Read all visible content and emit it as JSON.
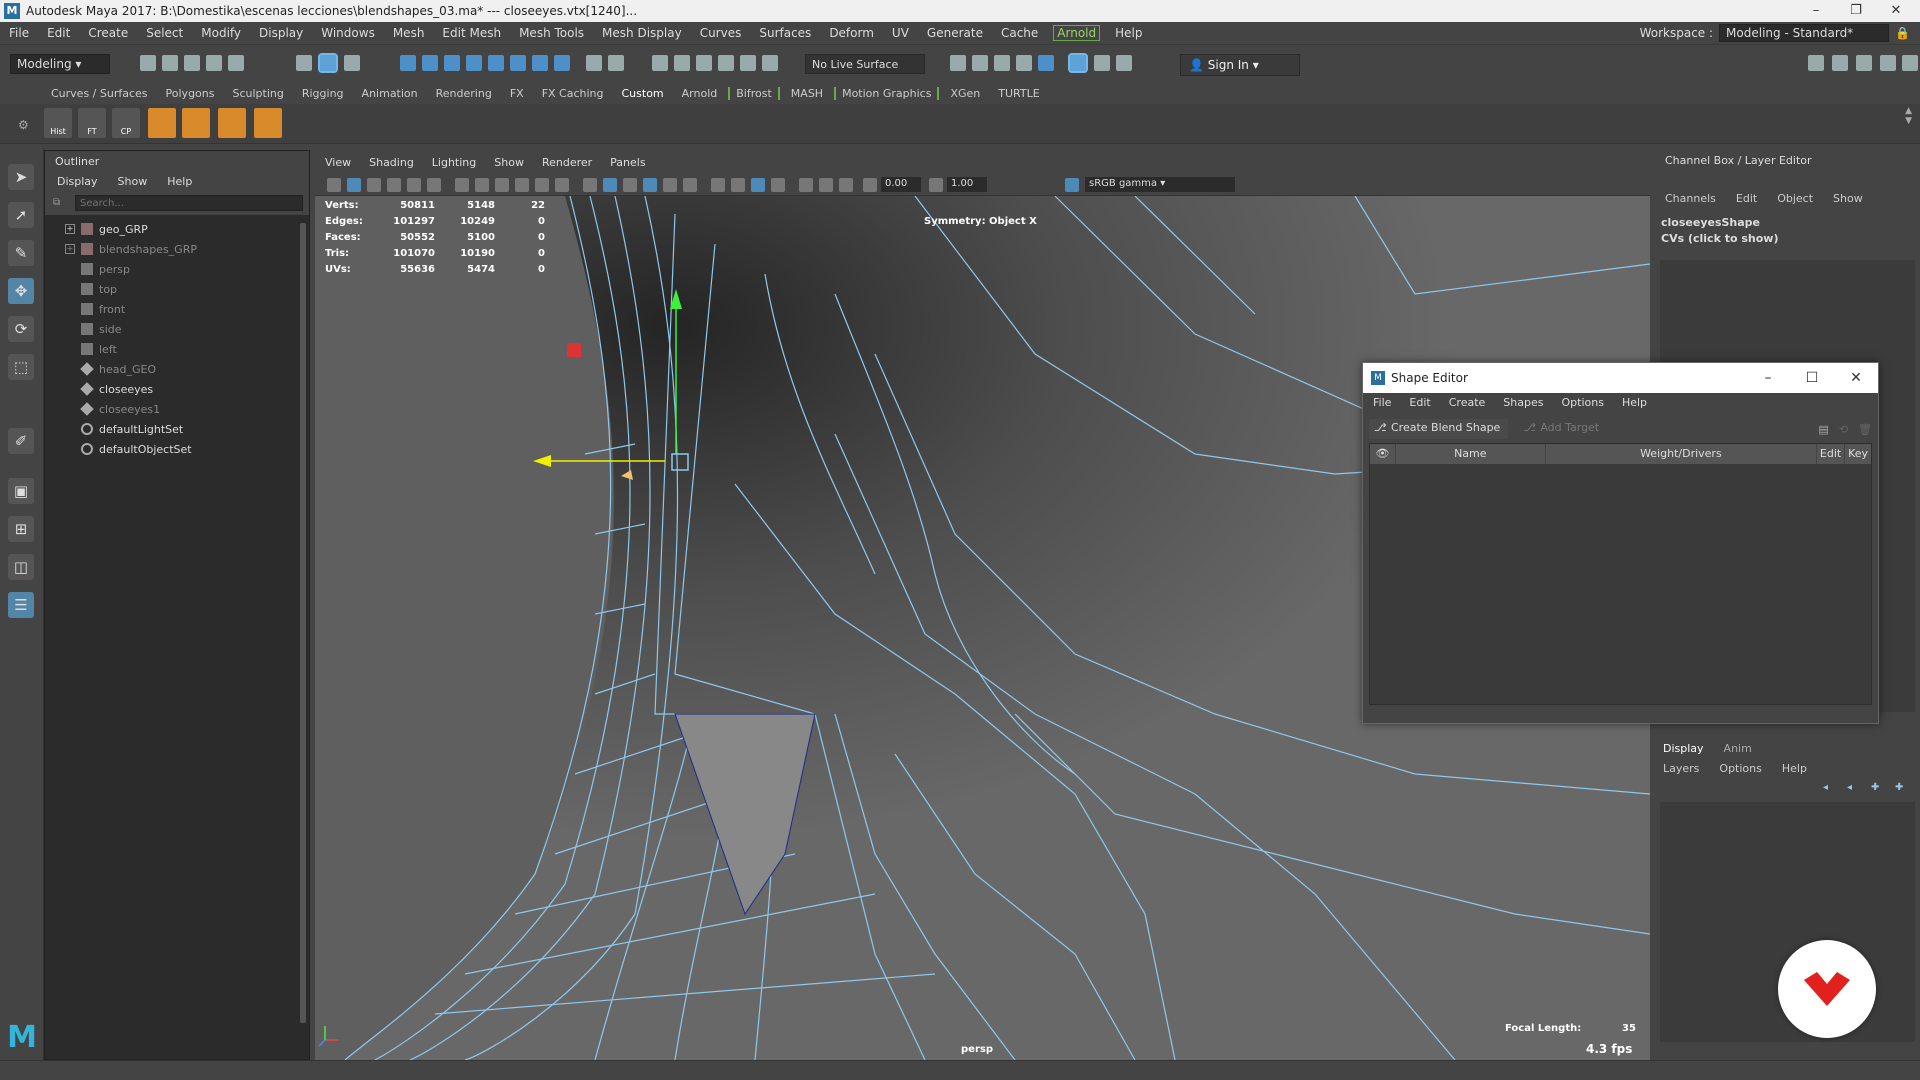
{
  "window": {
    "title": "Autodesk Maya 2017: B:\\Domestika\\escenas lecciones\\blendshapes_03.ma*  ---  closeeyes.vtx[1240]..."
  },
  "menubar": {
    "items": [
      "File",
      "Edit",
      "Create",
      "Select",
      "Modify",
      "Display",
      "Windows",
      "Mesh",
      "Edit Mesh",
      "Mesh Tools",
      "Mesh Display",
      "Curves",
      "Surfaces",
      "Deform",
      "UV",
      "Generate",
      "Cache",
      "Arnold",
      "Help"
    ],
    "workspace_label": "Workspace :",
    "workspace_value": "Modeling - Standard*"
  },
  "statusline": {
    "mode": "Modeling",
    "live_surface": "No Live Surface",
    "sign_in": "Sign In"
  },
  "shelf": {
    "tabs": [
      "Curves / Surfaces",
      "Polygons",
      "Sculpting",
      "Rigging",
      "Animation",
      "Rendering",
      "FX",
      "FX Caching",
      "Custom",
      "Arnold",
      "Bifrost",
      "MASH",
      "Motion Graphics",
      "XGen",
      "TURTLE"
    ],
    "active_tab": "Custom",
    "icons": [
      "Hist",
      "FT",
      "CP",
      "",
      "",
      "",
      ""
    ]
  },
  "outliner": {
    "title": "Outliner",
    "menu": [
      "Display",
      "Show",
      "Help"
    ],
    "search_placeholder": "Search...",
    "items": [
      {
        "label": "geo_GRP",
        "icon": "group-icon",
        "expandable": true,
        "dim": false
      },
      {
        "label": "blendshapes_GRP",
        "icon": "group-icon",
        "expandable": true,
        "dim": true
      },
      {
        "label": "persp",
        "icon": "camera-icon",
        "expandable": false,
        "dim": true
      },
      {
        "label": "top",
        "icon": "camera-icon",
        "expandable": false,
        "dim": true
      },
      {
        "label": "front",
        "icon": "camera-icon",
        "expandable": false,
        "dim": true
      },
      {
        "label": "side",
        "icon": "camera-icon",
        "expandable": false,
        "dim": true
      },
      {
        "label": "left",
        "icon": "camera-icon",
        "expandable": false,
        "dim": true
      },
      {
        "label": "head_GEO",
        "icon": "mesh-icon",
        "expandable": false,
        "dim": true
      },
      {
        "label": "closeeyes",
        "icon": "mesh-icon",
        "expandable": false,
        "dim": false
      },
      {
        "label": "closeeyes1",
        "icon": "mesh-icon",
        "expandable": false,
        "dim": true
      },
      {
        "label": "defaultLightSet",
        "icon": "set-icon",
        "expandable": false,
        "dim": false
      },
      {
        "label": "defaultObjectSet",
        "icon": "set-icon",
        "expandable": false,
        "dim": false
      }
    ]
  },
  "viewport": {
    "menu": [
      "View",
      "Shading",
      "Lighting",
      "Show",
      "Renderer",
      "Panels"
    ],
    "exposure": "0.00",
    "gamma": "1.00",
    "color_space": "sRGB gamma",
    "hud": {
      "stats": [
        {
          "label": "Verts:",
          "a": "50811",
          "b": "5148",
          "c": "22"
        },
        {
          "label": "Edges:",
          "a": "101297",
          "b": "10249",
          "c": "0"
        },
        {
          "label": "Faces:",
          "a": "50552",
          "b": "5100",
          "c": "0"
        },
        {
          "label": "Tris:",
          "a": "101070",
          "b": "10190",
          "c": "0"
        },
        {
          "label": "UVs:",
          "a": "55636",
          "b": "5474",
          "c": "0"
        }
      ],
      "symmetry": "Symmetry: Object X",
      "focal_label": "Focal Length:",
      "focal_value": "35",
      "fps": "4.3 fps",
      "camera": "persp"
    }
  },
  "shape_editor": {
    "title": "Shape Editor",
    "menu": [
      "File",
      "Edit",
      "Create",
      "Shapes",
      "Options",
      "Help"
    ],
    "create_blend": "Create Blend Shape",
    "add_target": "Add Target",
    "columns": [
      "Name",
      "Weight/Drivers",
      "Edit",
      "Key"
    ]
  },
  "channel_box": {
    "title": "Channel Box / Layer Editor",
    "menu": [
      "Channels",
      "Edit",
      "Object",
      "Show"
    ],
    "shape_name": "closeeyesShape",
    "cvs": "CVs (click to show)"
  },
  "layer_editor": {
    "tabs": [
      "Display",
      "Anim"
    ],
    "menu": [
      "Layers",
      "Options",
      "Help"
    ]
  },
  "colors": {
    "wire": "#8ec8ec",
    "accent": "#5285a6",
    "badge": "#e0211d"
  }
}
